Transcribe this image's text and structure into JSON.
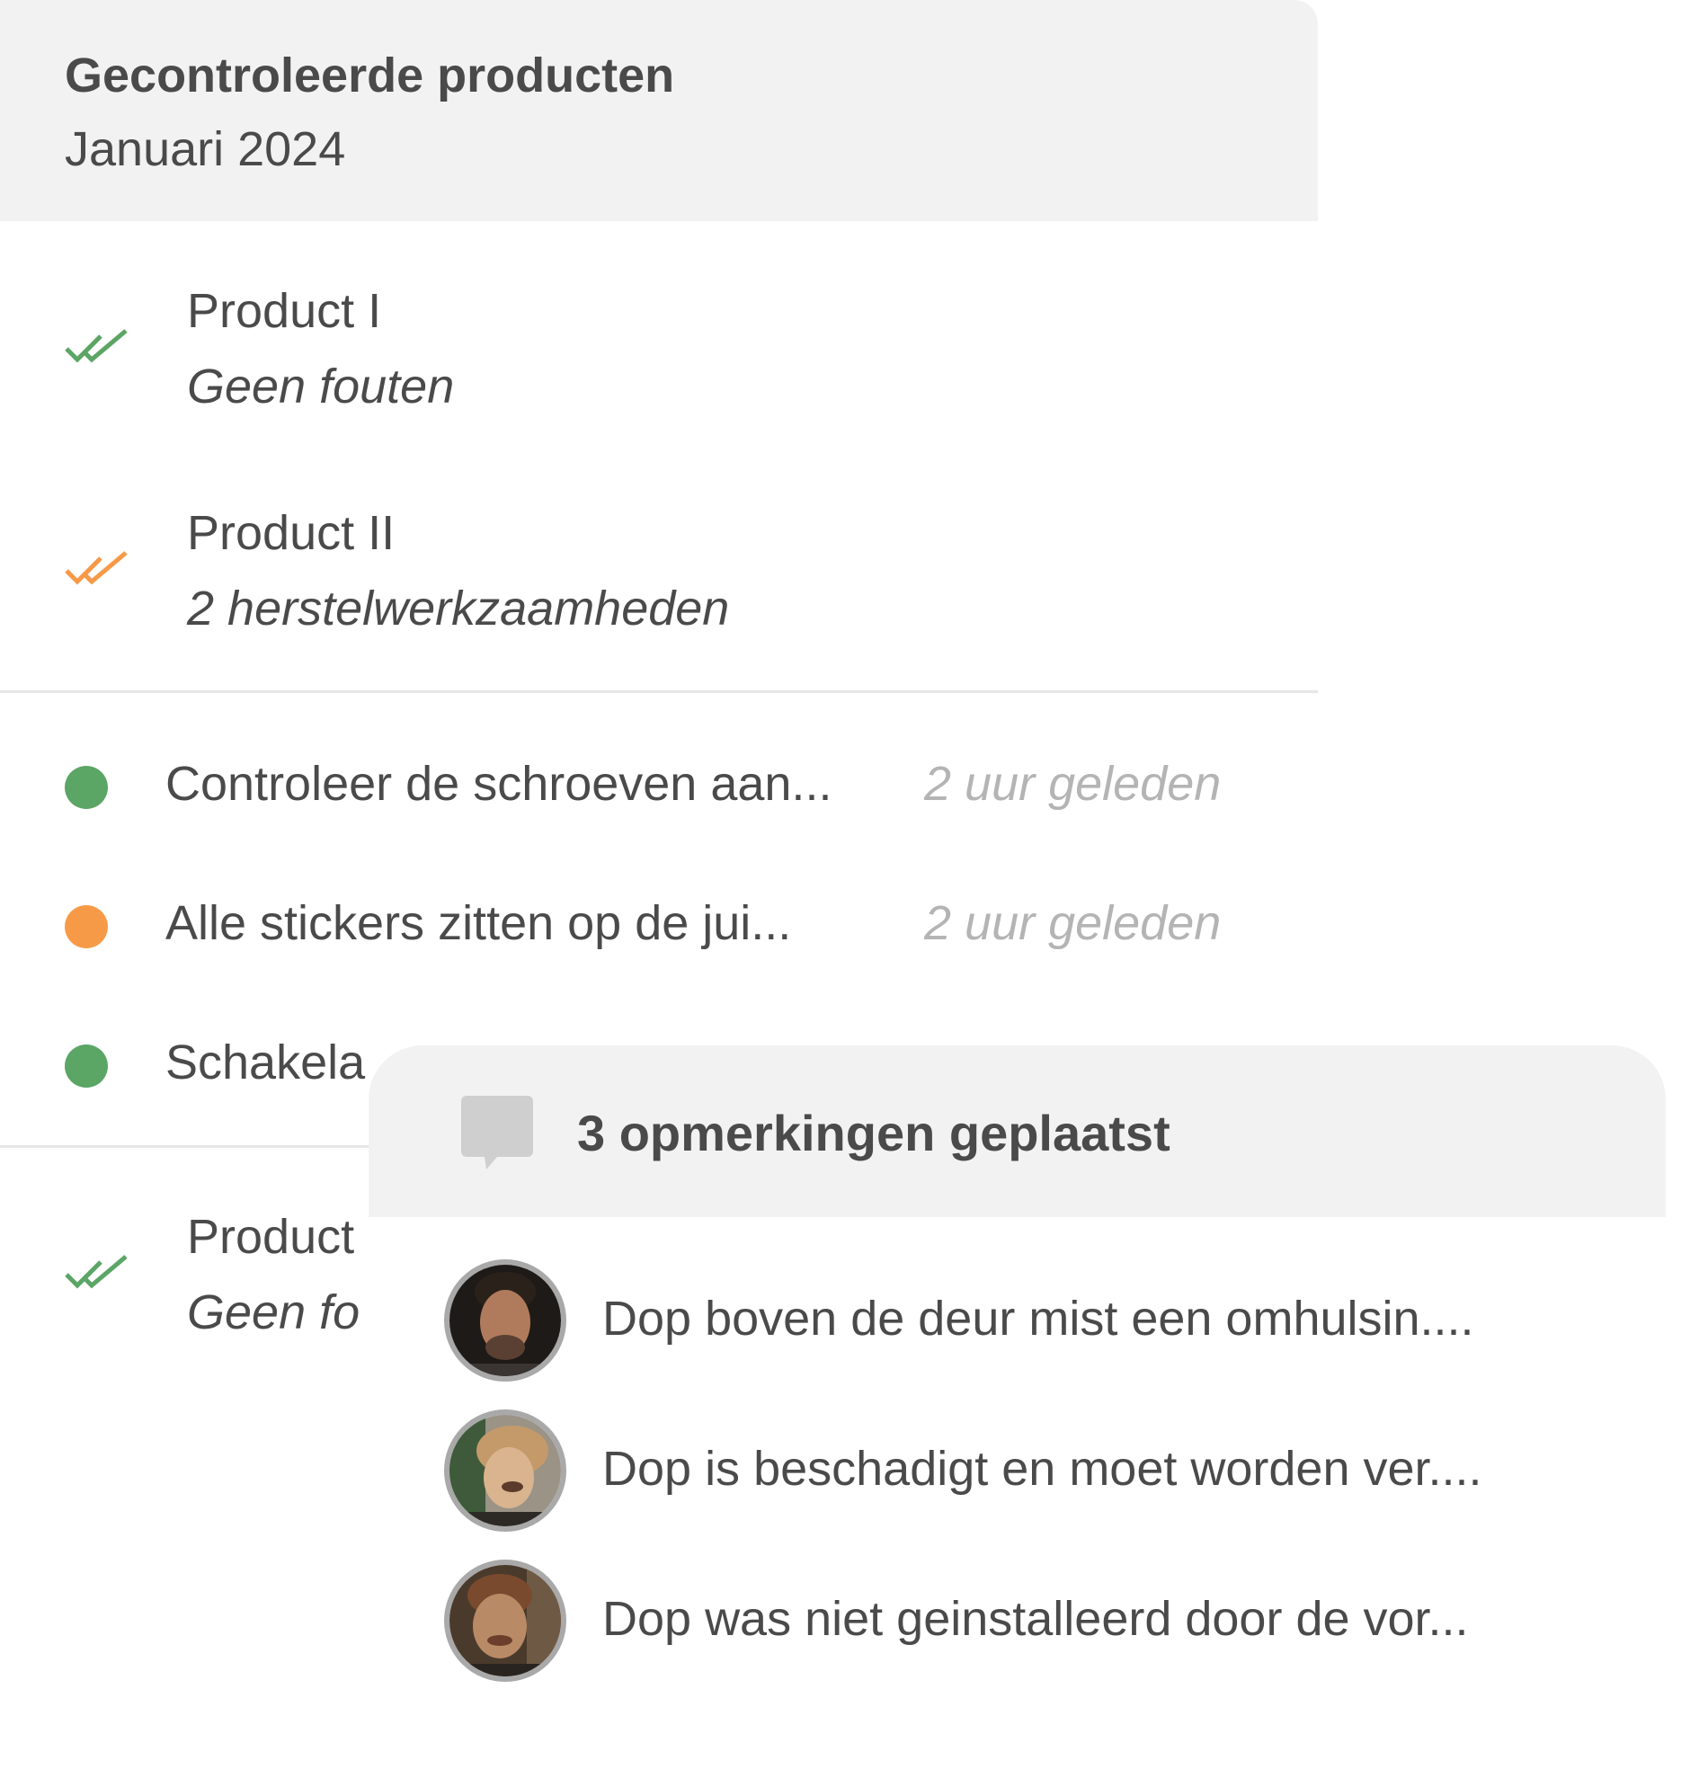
{
  "card": {
    "title": "Gecontroleerde producten",
    "subtitle": "Januari 2024",
    "products": [
      {
        "name": "Product I",
        "status": "Geen fouten",
        "check_color": "#5ba565"
      },
      {
        "name": "Product II",
        "status": "2 herstelwerkzaamheden",
        "check_color": "#f79a48"
      },
      {
        "name": "Product",
        "status": "Geen fo",
        "check_color": "#5ba565"
      }
    ],
    "tasks": [
      {
        "text": "Controleer de schroeven aan...",
        "time": "2 uur geleden",
        "dot_color": "#5ba565"
      },
      {
        "text": "Alle stickers zitten op de  jui...",
        "time": "2 uur geleden",
        "dot_color": "#f79a48"
      },
      {
        "text": "Schakela",
        "time": "",
        "dot_color": "#5ba565"
      }
    ]
  },
  "popup": {
    "title": "3 opmerkingen geplaatst",
    "icon": "comment-icon",
    "comments": [
      {
        "text": "Dop boven de deur mist een omhulsin...."
      },
      {
        "text": "Dop is beschadigt en moet worden ver...."
      },
      {
        "text": "Dop was niet geinstalleerd door de vor..."
      }
    ]
  },
  "colors": {
    "green": "#5ba565",
    "orange": "#f79a48",
    "text": "#4a4a4a",
    "muted": "#b4b4b4",
    "header_bg": "#f2f2f2"
  }
}
